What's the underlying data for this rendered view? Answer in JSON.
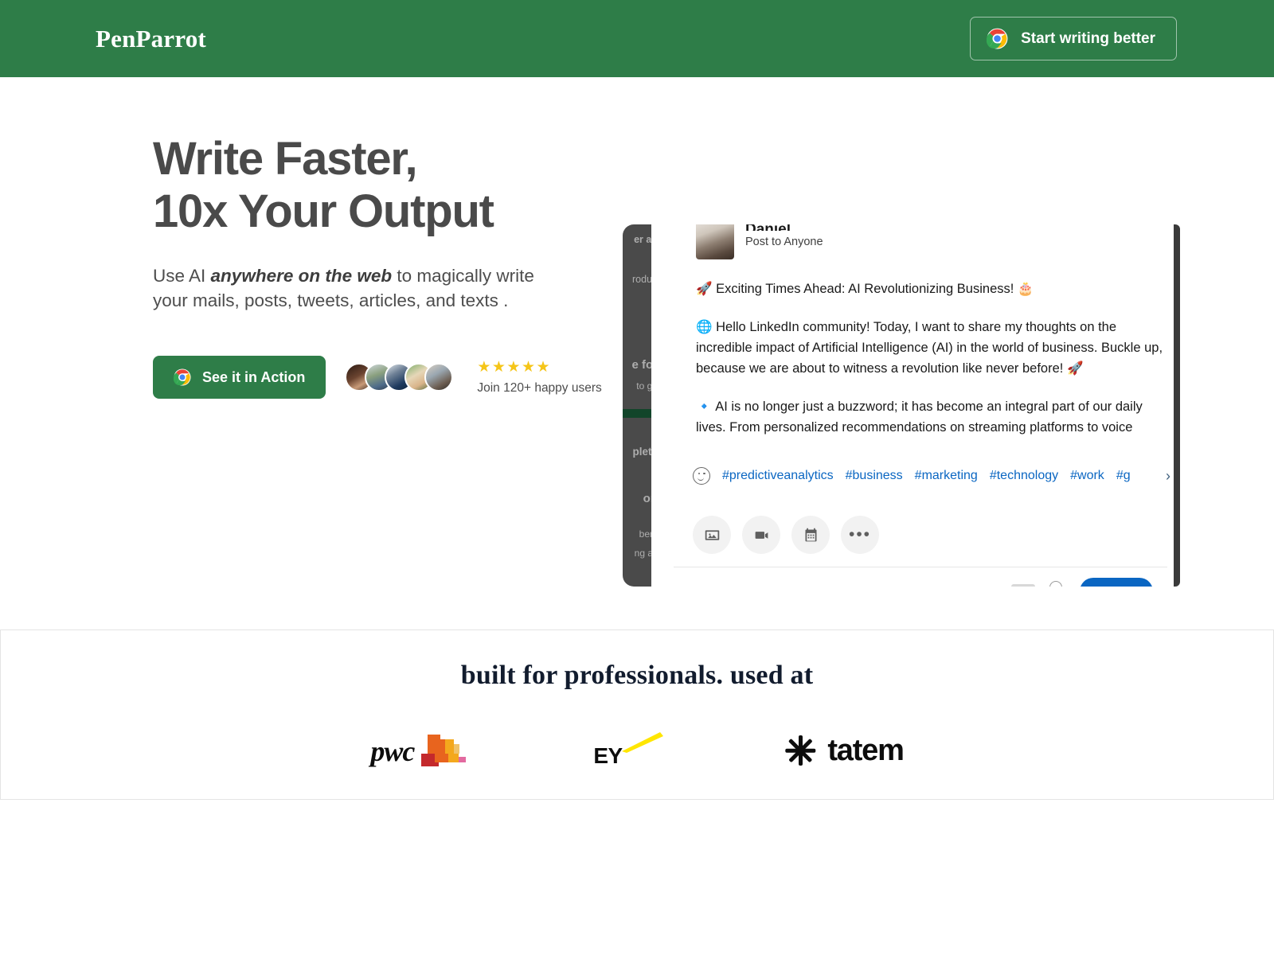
{
  "header": {
    "brand": "PenParrot",
    "cta_label": "Start writing better",
    "cta_icon": "chrome-icon",
    "bg_color": "#2E7D48"
  },
  "hero": {
    "headline_line1": "Write Faster,",
    "headline_line2": "10x Your Output",
    "subhead_prefix": "Use AI ",
    "subhead_emphasis": "anywhere on the web",
    "subhead_suffix": " to magically write your mails, posts, tweets, articles, and texts .",
    "cta_label": "See it in Action",
    "cta_icon": "chrome-icon",
    "cta_color": "#2E7D48",
    "stars": "★★★★★",
    "star_color": "#F5C518",
    "social_proof": "Join 120+ happy users",
    "avatar_count": 5
  },
  "mockup": {
    "author_name": "Daniel",
    "visibility": "Post to Anyone",
    "paragraphs": [
      "🚀 Exciting Times Ahead: AI Revolutionizing Business! 🎂",
      "🌐 Hello LinkedIn community! Today, I want to share my thoughts on the incredible impact of Artificial Intelligence (AI) in the world of business. Buckle up, because we are about to witness a revolution like never before! 🚀",
      "🔹 AI is no longer just a buzzword; it has become an integral part of our daily lives. From personalized recommendations on streaming platforms to voice"
    ],
    "hashtags": [
      "#predictiveanalytics",
      "#business",
      "#marketing",
      "#technology",
      "#work",
      "#g"
    ],
    "hashtag_color": "#0a66c2",
    "chevron": "›",
    "emoji_button": "smiley-icon",
    "toolbar_icons": [
      "image-icon",
      "video-icon",
      "calendar-icon",
      "more-icon"
    ],
    "more_glyph": "•••",
    "post_button_color": "#0a66c2",
    "sidebar_fragments": [
      "er ad",
      "rodue",
      "e for",
      "to ge",
      "plete",
      "on",
      "bers",
      "ng a l"
    ]
  },
  "logos_section": {
    "title": "built for professionals. used at",
    "logos": [
      {
        "name": "pwc",
        "text": "pwc"
      },
      {
        "name": "ey",
        "text": "EY"
      },
      {
        "name": "tatem",
        "text": "tatem"
      }
    ]
  }
}
